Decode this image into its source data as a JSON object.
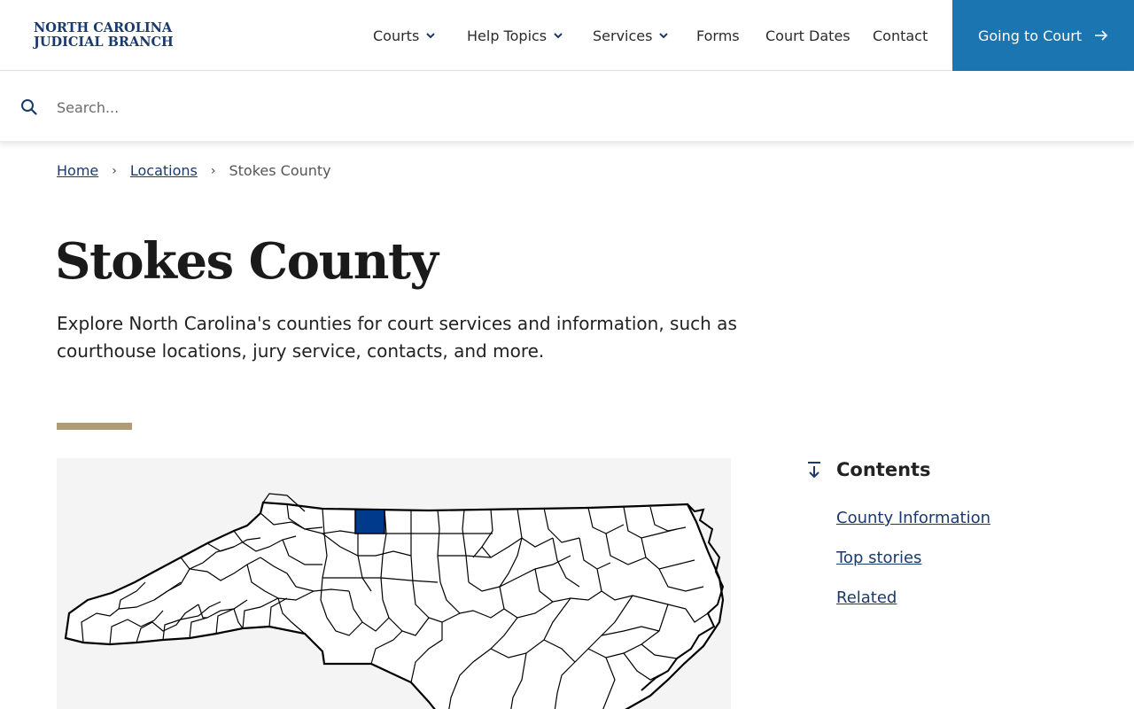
{
  "header": {
    "logo_line1": "NORTH CAROLINA",
    "logo_line2": "JUDICIAL BRANCH",
    "nav": [
      {
        "label": "Courts",
        "dropdown": true
      },
      {
        "label": "Help Topics",
        "dropdown": true
      },
      {
        "label": "Services",
        "dropdown": true
      },
      {
        "label": "Forms",
        "dropdown": false
      },
      {
        "label": "Court Dates",
        "dropdown": false
      },
      {
        "label": "Contact",
        "dropdown": false
      }
    ],
    "cta_label": "Going to Court"
  },
  "search": {
    "placeholder": "Search...",
    "value": ""
  },
  "breadcrumb": {
    "home": "Home",
    "locations": "Locations",
    "current": "Stokes County"
  },
  "page": {
    "title": "Stokes County",
    "intro": "Explore North Carolina's counties for court services and information, such as courthouse locations, jury service, contacts, and more."
  },
  "contents": {
    "title": "Contents",
    "items": [
      "County Information",
      "Top stories",
      "Related"
    ]
  },
  "colors": {
    "brand_navy": "#1b3a6b",
    "cta_blue": "#1b75b0",
    "accent_gold": "#ad9c74",
    "highlight_county": "#003a8c"
  },
  "icons": {
    "search": "search-icon",
    "chevron": "chevron-down-icon",
    "arrow": "arrow-right-icon",
    "contents": "jump-down-icon"
  }
}
